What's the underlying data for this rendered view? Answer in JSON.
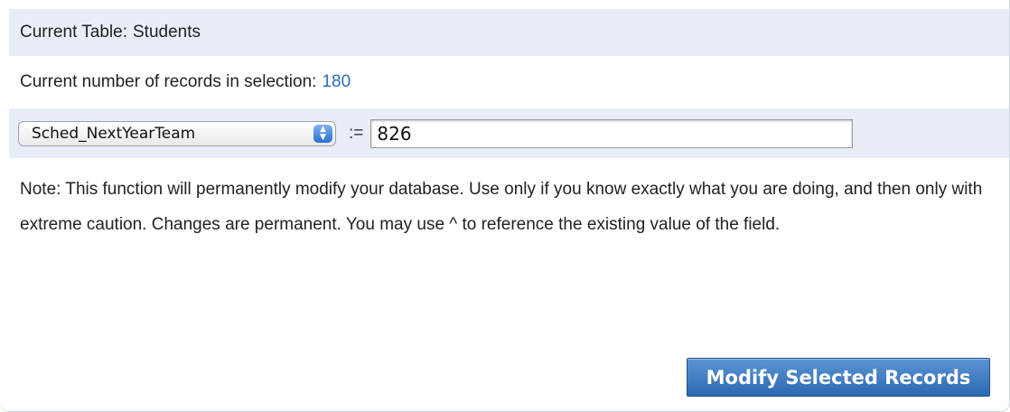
{
  "table": {
    "label": "Current Table:",
    "name": "Students"
  },
  "records": {
    "label": "Current number of records in selection:",
    "count": "180"
  },
  "editor": {
    "field_selected": "Sched_NextYearTeam",
    "assign_operator": ":=",
    "value": "826"
  },
  "note": "Note: This function will permanently modify your database. Use only if you know exactly what you are doing, and then only with extreme caution. Changes are permanent. You may use ^ to reference the existing value of the field.",
  "actions": {
    "modify_label": "Modify Selected Records"
  },
  "colors": {
    "row_highlight": "#e8edf8",
    "count_accent": "#2a6db7",
    "button_blue": "#2c69b3"
  }
}
